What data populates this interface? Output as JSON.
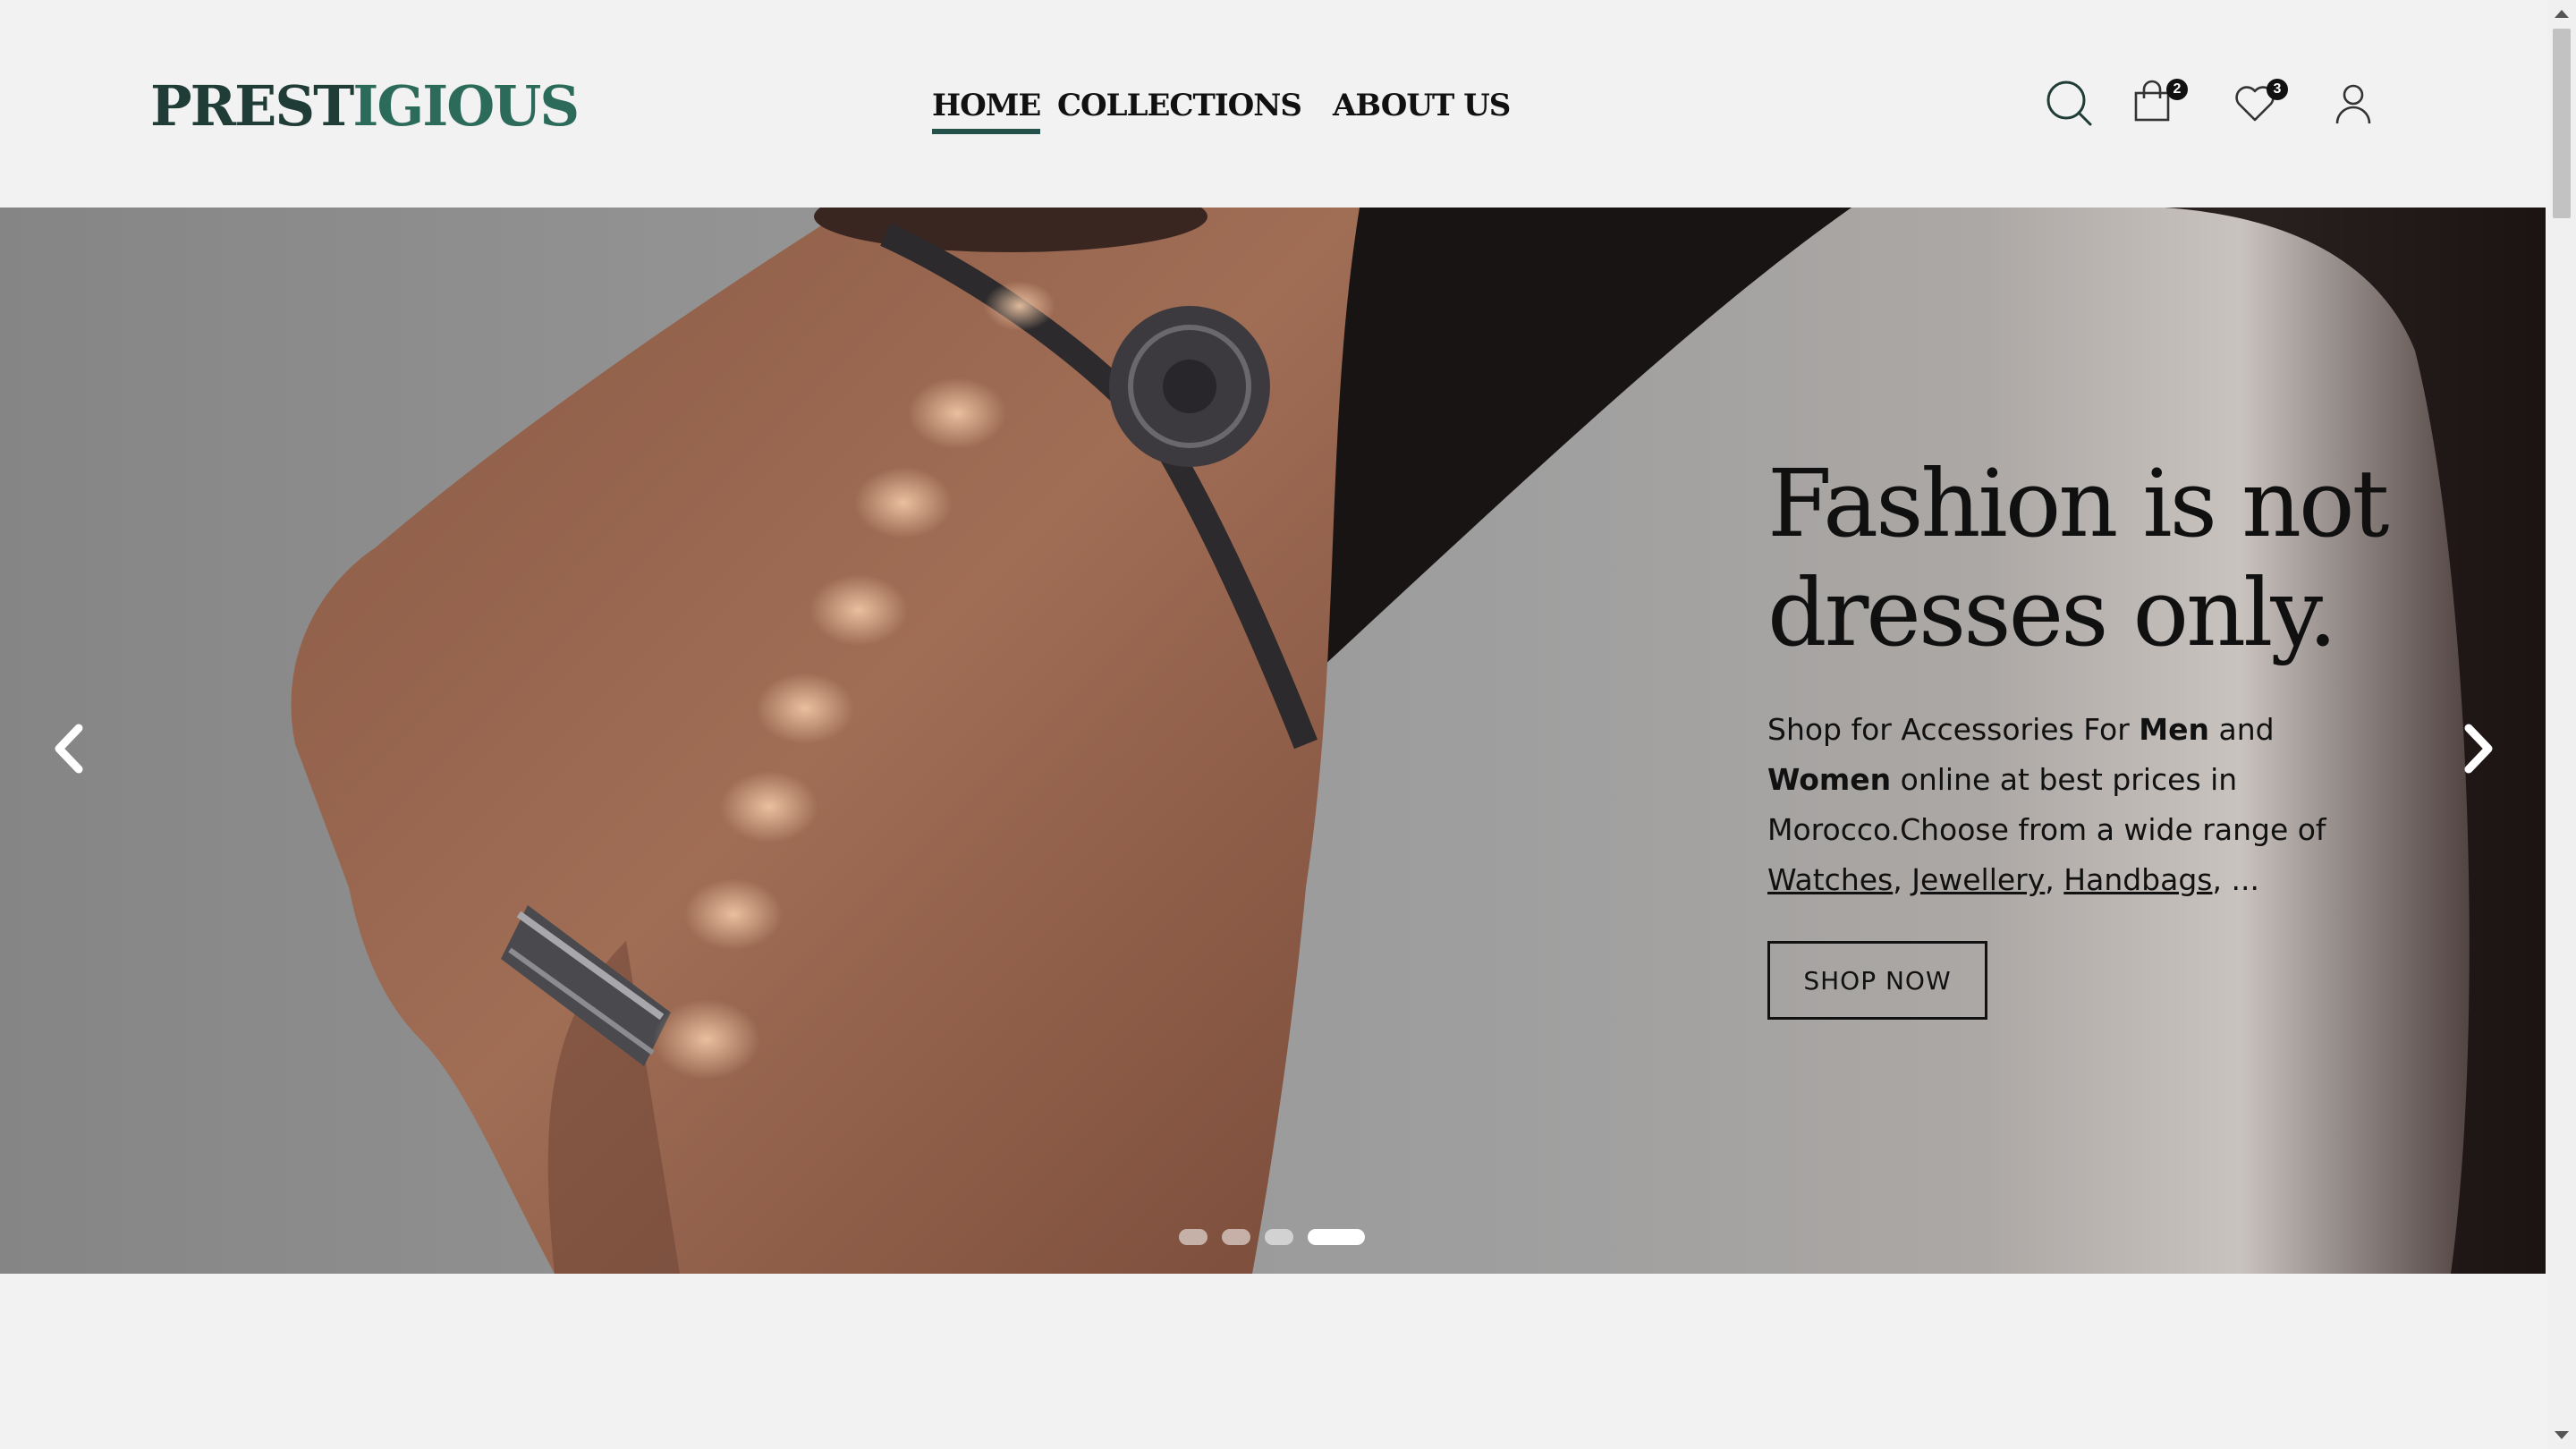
{
  "header": {
    "logo": {
      "part1": "PREST",
      "part2": "IGIOUS"
    },
    "nav": [
      {
        "label": "HOME",
        "active": true
      },
      {
        "label": "COLLECTIONS",
        "active": false
      },
      {
        "label": "ABOUT US",
        "active": false
      }
    ],
    "icons": {
      "search": "search-icon",
      "cart": "shopping-bag-icon",
      "wishlist": "heart-icon",
      "account": "user-icon"
    },
    "cart_count": "2",
    "wishlist_count": "3"
  },
  "hero": {
    "title_line1": "Fashion is not",
    "title_line2": "dresses only.",
    "text": {
      "part1": "Shop for Accessories For ",
      "men": "Men",
      "part2": " and ",
      "women": "Women",
      "part3": " online at best prices in Morocco.Choose from a wide range of ",
      "link1": "Watches",
      "sep1": ", ",
      "link2": "Jewellery",
      "sep2": ", ",
      "link3": "Handbags",
      "end": ", ..."
    },
    "cta": "SHOP NOW",
    "slides_total": 4,
    "active_slide": 4
  },
  "colors": {
    "logo": "#1f3c36",
    "logo_accent": "#2c6b59",
    "nav_underline": "#24524a",
    "background": "#f2f2f2"
  }
}
